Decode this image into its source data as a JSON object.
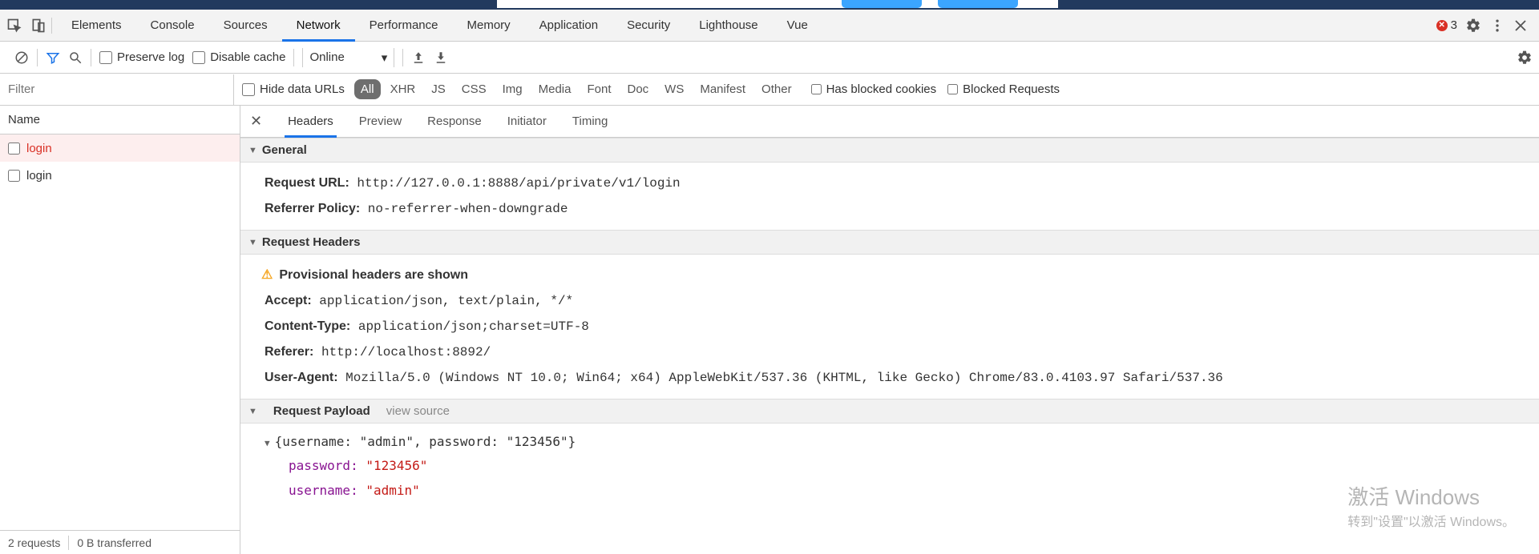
{
  "mainTabs": [
    "Elements",
    "Console",
    "Sources",
    "Network",
    "Performance",
    "Memory",
    "Application",
    "Security",
    "Lighthouse",
    "Vue"
  ],
  "activeMainTab": "Network",
  "errorCount": "3",
  "toolbar": {
    "preserveLog": "Preserve log",
    "disableCache": "Disable cache",
    "throttling": "Online"
  },
  "filter": {
    "placeholder": "Filter",
    "hideDataUrls": "Hide data URLs",
    "types": [
      "All",
      "XHR",
      "JS",
      "CSS",
      "Img",
      "Media",
      "Font",
      "Doc",
      "WS",
      "Manifest",
      "Other"
    ],
    "activeType": "All",
    "hasBlockedCookies": "Has blocked cookies",
    "blockedRequests": "Blocked Requests"
  },
  "leftHeader": "Name",
  "requests": [
    {
      "name": "login",
      "selected": true
    },
    {
      "name": "login",
      "selected": false
    }
  ],
  "status": {
    "requests": "2 requests",
    "transferred": "0 B transferred"
  },
  "detailTabs": [
    "Headers",
    "Preview",
    "Response",
    "Initiator",
    "Timing"
  ],
  "activeDetailTab": "Headers",
  "sections": {
    "general": {
      "title": "General",
      "rows": [
        {
          "k": "Request URL:",
          "v": "http://127.0.0.1:8888/api/private/v1/login"
        },
        {
          "k": "Referrer Policy:",
          "v": "no-referrer-when-downgrade"
        }
      ]
    },
    "requestHeaders": {
      "title": "Request Headers",
      "warning": "Provisional headers are shown",
      "rows": [
        {
          "k": "Accept:",
          "v": "application/json, text/plain, */*"
        },
        {
          "k": "Content-Type:",
          "v": "application/json;charset=UTF-8"
        },
        {
          "k": "Referer:",
          "v": "http://localhost:8892/"
        },
        {
          "k": "User-Agent:",
          "v": "Mozilla/5.0 (Windows NT 10.0; Win64; x64) AppleWebKit/537.36 (KHTML, like Gecko) Chrome/83.0.4103.97 Safari/537.36"
        }
      ]
    },
    "payload": {
      "title": "Request Payload",
      "viewSource": "view source",
      "summary": "{username: \"admin\", password: \"123456\"}",
      "items": [
        {
          "k": "password:",
          "v": "\"123456\""
        },
        {
          "k": "username:",
          "v": "\"admin\""
        }
      ]
    }
  },
  "watermark": {
    "l1": "激活 Windows",
    "l2": "转到\"设置\"以激活 Windows。"
  }
}
